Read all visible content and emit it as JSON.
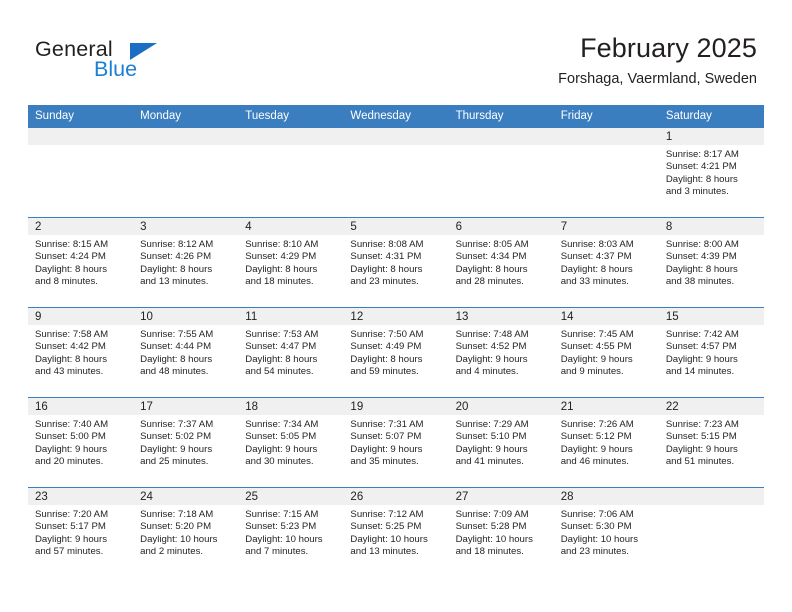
{
  "brand": {
    "name_part1": "General",
    "name_part2": "Blue",
    "triangle_icon": "triangle-icon",
    "colors": {
      "general": "#231f20",
      "blue": "#1b7fd4",
      "triangle": "#1b6ec2"
    }
  },
  "header": {
    "title": "February 2025",
    "subtitle": "Forshaga, Vaermland, Sweden"
  },
  "colors": {
    "header_row_bg": "#3a7ec0",
    "header_row_text": "#ffffff",
    "daynum_band_bg": "#f0f0f0",
    "grid_line": "#3a7ec0",
    "cell_bg": "#ffffff",
    "text": "#231f20"
  },
  "weekday_headers": [
    "Sunday",
    "Monday",
    "Tuesday",
    "Wednesday",
    "Thursday",
    "Friday",
    "Saturday"
  ],
  "labels": {
    "sunrise": "Sunrise:",
    "sunset": "Sunset:",
    "daylight": "Daylight:"
  },
  "weeks": [
    [
      {
        "day": "",
        "empty": true
      },
      {
        "day": "",
        "empty": true
      },
      {
        "day": "",
        "empty": true
      },
      {
        "day": "",
        "empty": true
      },
      {
        "day": "",
        "empty": true
      },
      {
        "day": "",
        "empty": true
      },
      {
        "day": "1",
        "sunrise": "Sunrise: 8:17 AM",
        "sunset": "Sunset: 4:21 PM",
        "daylight_line1": "Daylight: 8 hours",
        "daylight_line2": "and 3 minutes."
      }
    ],
    [
      {
        "day": "2",
        "sunrise": "Sunrise: 8:15 AM",
        "sunset": "Sunset: 4:24 PM",
        "daylight_line1": "Daylight: 8 hours",
        "daylight_line2": "and 8 minutes."
      },
      {
        "day": "3",
        "sunrise": "Sunrise: 8:12 AM",
        "sunset": "Sunset: 4:26 PM",
        "daylight_line1": "Daylight: 8 hours",
        "daylight_line2": "and 13 minutes."
      },
      {
        "day": "4",
        "sunrise": "Sunrise: 8:10 AM",
        "sunset": "Sunset: 4:29 PM",
        "daylight_line1": "Daylight: 8 hours",
        "daylight_line2": "and 18 minutes."
      },
      {
        "day": "5",
        "sunrise": "Sunrise: 8:08 AM",
        "sunset": "Sunset: 4:31 PM",
        "daylight_line1": "Daylight: 8 hours",
        "daylight_line2": "and 23 minutes."
      },
      {
        "day": "6",
        "sunrise": "Sunrise: 8:05 AM",
        "sunset": "Sunset: 4:34 PM",
        "daylight_line1": "Daylight: 8 hours",
        "daylight_line2": "and 28 minutes."
      },
      {
        "day": "7",
        "sunrise": "Sunrise: 8:03 AM",
        "sunset": "Sunset: 4:37 PM",
        "daylight_line1": "Daylight: 8 hours",
        "daylight_line2": "and 33 minutes."
      },
      {
        "day": "8",
        "sunrise": "Sunrise: 8:00 AM",
        "sunset": "Sunset: 4:39 PM",
        "daylight_line1": "Daylight: 8 hours",
        "daylight_line2": "and 38 minutes."
      }
    ],
    [
      {
        "day": "9",
        "sunrise": "Sunrise: 7:58 AM",
        "sunset": "Sunset: 4:42 PM",
        "daylight_line1": "Daylight: 8 hours",
        "daylight_line2": "and 43 minutes."
      },
      {
        "day": "10",
        "sunrise": "Sunrise: 7:55 AM",
        "sunset": "Sunset: 4:44 PM",
        "daylight_line1": "Daylight: 8 hours",
        "daylight_line2": "and 48 minutes."
      },
      {
        "day": "11",
        "sunrise": "Sunrise: 7:53 AM",
        "sunset": "Sunset: 4:47 PM",
        "daylight_line1": "Daylight: 8 hours",
        "daylight_line2": "and 54 minutes."
      },
      {
        "day": "12",
        "sunrise": "Sunrise: 7:50 AM",
        "sunset": "Sunset: 4:49 PM",
        "daylight_line1": "Daylight: 8 hours",
        "daylight_line2": "and 59 minutes."
      },
      {
        "day": "13",
        "sunrise": "Sunrise: 7:48 AM",
        "sunset": "Sunset: 4:52 PM",
        "daylight_line1": "Daylight: 9 hours",
        "daylight_line2": "and 4 minutes."
      },
      {
        "day": "14",
        "sunrise": "Sunrise: 7:45 AM",
        "sunset": "Sunset: 4:55 PM",
        "daylight_line1": "Daylight: 9 hours",
        "daylight_line2": "and 9 minutes."
      },
      {
        "day": "15",
        "sunrise": "Sunrise: 7:42 AM",
        "sunset": "Sunset: 4:57 PM",
        "daylight_line1": "Daylight: 9 hours",
        "daylight_line2": "and 14 minutes."
      }
    ],
    [
      {
        "day": "16",
        "sunrise": "Sunrise: 7:40 AM",
        "sunset": "Sunset: 5:00 PM",
        "daylight_line1": "Daylight: 9 hours",
        "daylight_line2": "and 20 minutes."
      },
      {
        "day": "17",
        "sunrise": "Sunrise: 7:37 AM",
        "sunset": "Sunset: 5:02 PM",
        "daylight_line1": "Daylight: 9 hours",
        "daylight_line2": "and 25 minutes."
      },
      {
        "day": "18",
        "sunrise": "Sunrise: 7:34 AM",
        "sunset": "Sunset: 5:05 PM",
        "daylight_line1": "Daylight: 9 hours",
        "daylight_line2": "and 30 minutes."
      },
      {
        "day": "19",
        "sunrise": "Sunrise: 7:31 AM",
        "sunset": "Sunset: 5:07 PM",
        "daylight_line1": "Daylight: 9 hours",
        "daylight_line2": "and 35 minutes."
      },
      {
        "day": "20",
        "sunrise": "Sunrise: 7:29 AM",
        "sunset": "Sunset: 5:10 PM",
        "daylight_line1": "Daylight: 9 hours",
        "daylight_line2": "and 41 minutes."
      },
      {
        "day": "21",
        "sunrise": "Sunrise: 7:26 AM",
        "sunset": "Sunset: 5:12 PM",
        "daylight_line1": "Daylight: 9 hours",
        "daylight_line2": "and 46 minutes."
      },
      {
        "day": "22",
        "sunrise": "Sunrise: 7:23 AM",
        "sunset": "Sunset: 5:15 PM",
        "daylight_line1": "Daylight: 9 hours",
        "daylight_line2": "and 51 minutes."
      }
    ],
    [
      {
        "day": "23",
        "sunrise": "Sunrise: 7:20 AM",
        "sunset": "Sunset: 5:17 PM",
        "daylight_line1": "Daylight: 9 hours",
        "daylight_line2": "and 57 minutes."
      },
      {
        "day": "24",
        "sunrise": "Sunrise: 7:18 AM",
        "sunset": "Sunset: 5:20 PM",
        "daylight_line1": "Daylight: 10 hours",
        "daylight_line2": "and 2 minutes."
      },
      {
        "day": "25",
        "sunrise": "Sunrise: 7:15 AM",
        "sunset": "Sunset: 5:23 PM",
        "daylight_line1": "Daylight: 10 hours",
        "daylight_line2": "and 7 minutes."
      },
      {
        "day": "26",
        "sunrise": "Sunrise: 7:12 AM",
        "sunset": "Sunset: 5:25 PM",
        "daylight_line1": "Daylight: 10 hours",
        "daylight_line2": "and 13 minutes."
      },
      {
        "day": "27",
        "sunrise": "Sunrise: 7:09 AM",
        "sunset": "Sunset: 5:28 PM",
        "daylight_line1": "Daylight: 10 hours",
        "daylight_line2": "and 18 minutes."
      },
      {
        "day": "28",
        "sunrise": "Sunrise: 7:06 AM",
        "sunset": "Sunset: 5:30 PM",
        "daylight_line1": "Daylight: 10 hours",
        "daylight_line2": "and 23 minutes."
      },
      {
        "day": "",
        "empty": true
      }
    ]
  ]
}
